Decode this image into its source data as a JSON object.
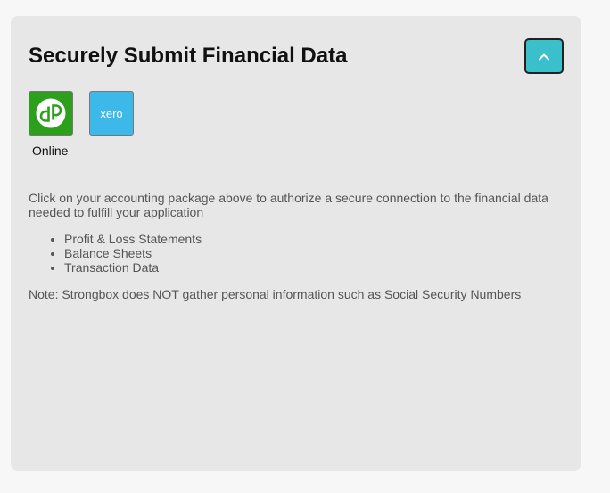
{
  "panel": {
    "title": "Securely Submit Financial Data",
    "collapse_icon": "chevron-up-icon",
    "accent_color": "#3bbfcb"
  },
  "providers": [
    {
      "name": "QuickBooks",
      "logo_text": "qb",
      "label": "Online",
      "color": "#2ca01c"
    },
    {
      "name": "Xero",
      "logo_text": "xero",
      "label": "",
      "color": "#3cb9e8"
    }
  ],
  "description": "Click on your accounting package above to authorize a secure connection to the financial data needed to fulfill your application",
  "items": [
    "Profit & Loss Statements",
    "Balance Sheets",
    "Transaction Data"
  ],
  "note": "Note: Strongbox does NOT gather personal information such as Social Security Numbers"
}
